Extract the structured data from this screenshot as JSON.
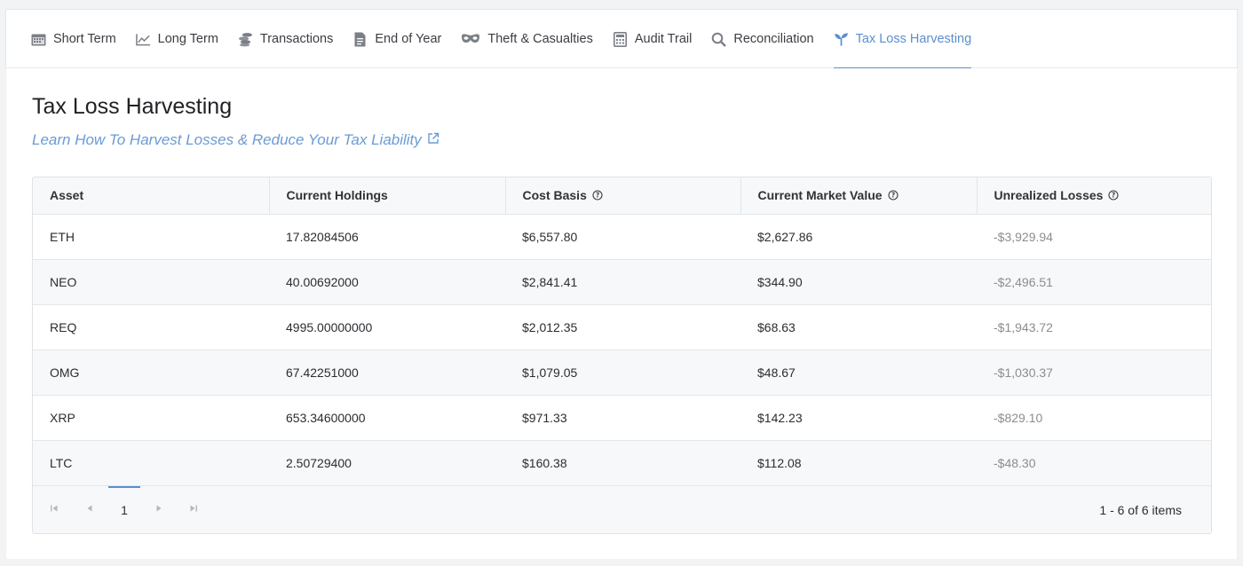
{
  "tabs": [
    {
      "label": "Short Term",
      "icon": "calendar-icon"
    },
    {
      "label": "Long Term",
      "icon": "line-chart-icon"
    },
    {
      "label": "Transactions",
      "icon": "coins-icon"
    },
    {
      "label": "End of Year",
      "icon": "document-icon"
    },
    {
      "label": "Theft & Casualties",
      "icon": "mask-icon"
    },
    {
      "label": "Audit Trail",
      "icon": "calculator-icon"
    },
    {
      "label": "Reconciliation",
      "icon": "search-icon"
    },
    {
      "label": "Tax Loss Harvesting",
      "icon": "sprout-icon",
      "active": true
    }
  ],
  "page": {
    "title": "Tax Loss Harvesting",
    "learn_link": "Learn How To Harvest Losses & Reduce Your Tax Liability"
  },
  "table": {
    "headers": [
      "Asset",
      "Current Holdings",
      "Cost Basis",
      "Current Market Value",
      "Unrealized Losses"
    ],
    "rows": [
      [
        "ETH",
        "17.82084506",
        "$6,557.80",
        "$2,627.86",
        "-$3,929.94"
      ],
      [
        "NEO",
        "40.00692000",
        "$2,841.41",
        "$344.90",
        "-$2,496.51"
      ],
      [
        "REQ",
        "4995.00000000",
        "$2,012.35",
        "$68.63",
        "-$1,943.72"
      ],
      [
        "OMG",
        "67.42251000",
        "$1,079.05",
        "$48.67",
        "-$1,030.37"
      ],
      [
        "XRP",
        "653.34600000",
        "$971.33",
        "$142.23",
        "-$829.10"
      ],
      [
        "LTC",
        "2.50729400",
        "$160.38",
        "$112.08",
        "-$48.30"
      ]
    ]
  },
  "pager": {
    "current_page": "1",
    "info": "1 - 6 of 6 items"
  },
  "colors": {
    "accent": "#5b8fd0",
    "link": "#6a9bd6",
    "loss_text": "#8a8d91"
  }
}
